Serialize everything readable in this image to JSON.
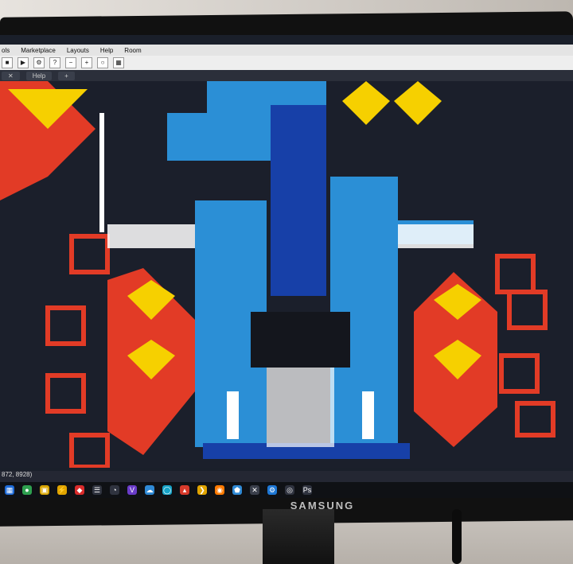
{
  "window": {
    "menu": [
      "ols",
      "Marketplace",
      "Layouts",
      "Help",
      "Room"
    ],
    "tab_label": "Help"
  },
  "toolbar": {
    "icons": [
      "stop-icon",
      "play-icon",
      "settings-icon",
      "help-icon",
      "zoom-out-icon",
      "zoom-in-icon",
      "zoom-reset-icon",
      "grid-icon"
    ]
  },
  "status": {
    "coordinates": "872, 8928)"
  },
  "taskbar": {
    "icons": [
      "calendar-icon",
      "chrome-icon",
      "notes-icon",
      "lightning-icon",
      "gem-icon",
      "chat-icon",
      "alarm-icon",
      "visualstudio-icon",
      "cloud-icon",
      "globe-icon",
      "popcorn-icon",
      "plex-icon",
      "firefox-icon",
      "nav-icon",
      "xmark-icon",
      "gear-icon",
      "steam-icon",
      "photoshop-icon"
    ]
  },
  "monitor": {
    "brand": "SAMSUNG"
  },
  "colors": {
    "red": "#e23b26",
    "yellow": "#f6d000",
    "blue": "#2b8fd6",
    "navy": "#1740a8",
    "dark": "#1b1f2b"
  }
}
